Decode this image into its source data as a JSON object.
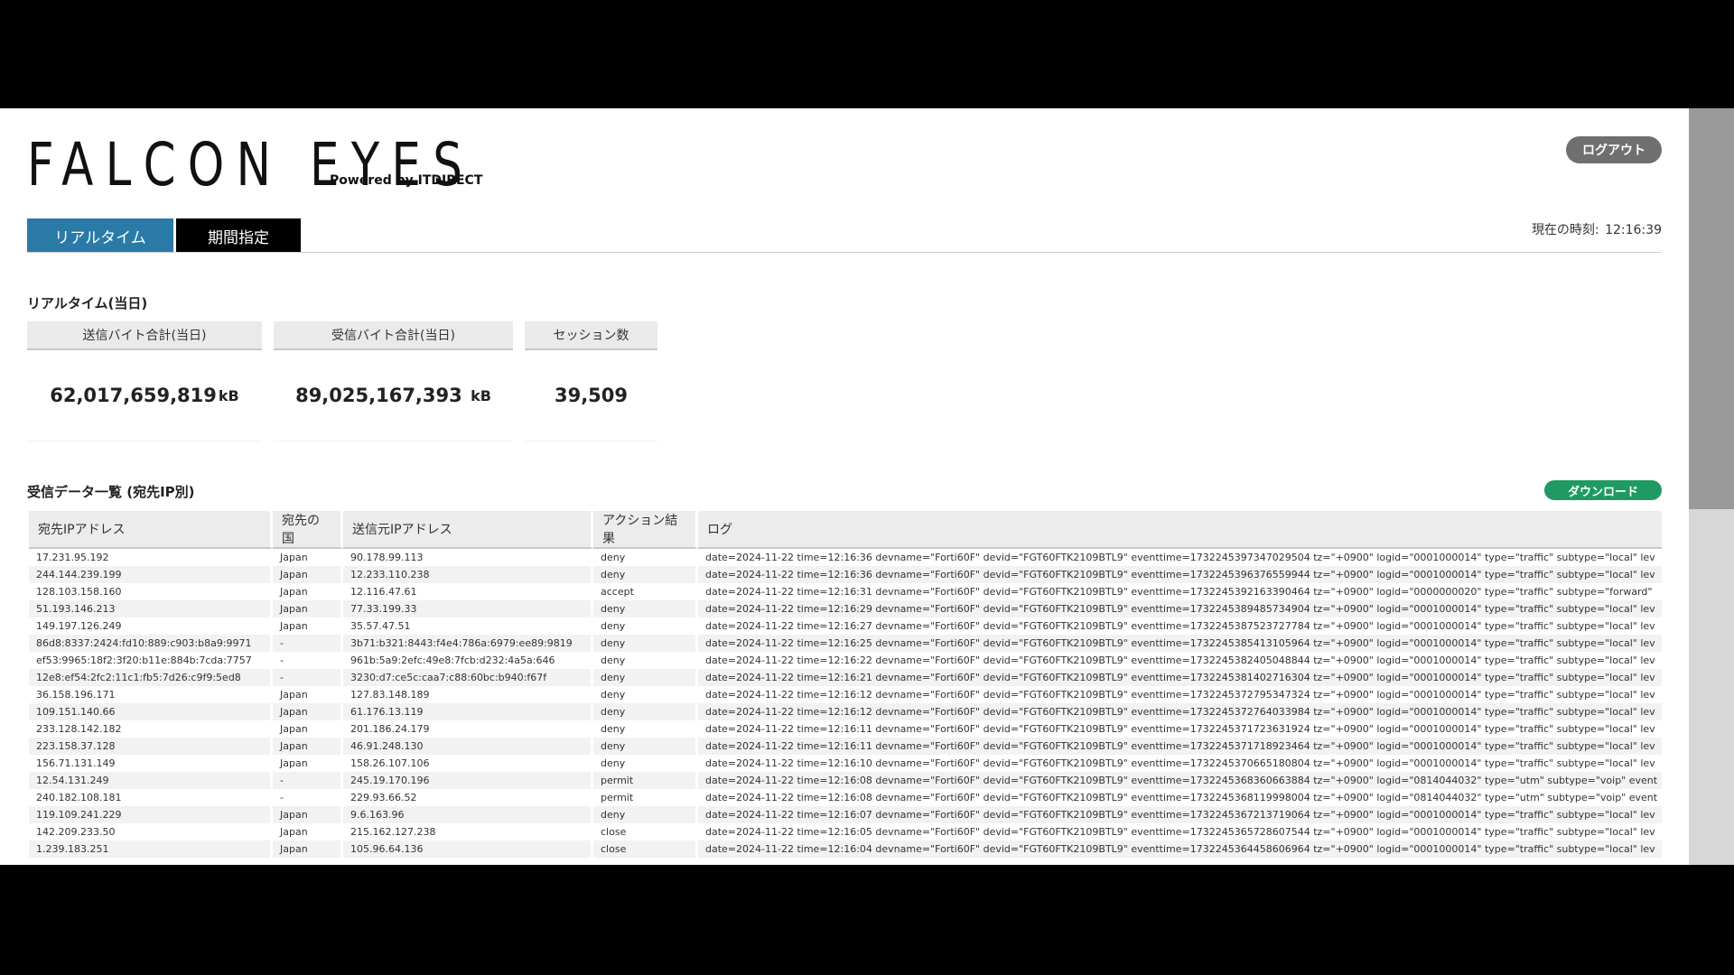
{
  "header": {
    "logo": "FALCON EYES",
    "powered_by": "Powered by ITDIRECT",
    "logout_label": "ログアウト",
    "clock_label": "現在の時刻:",
    "clock_time": "12:16:39"
  },
  "tabs": [
    {
      "label": "リアルタイム",
      "active": true
    },
    {
      "label": "期間指定",
      "active": false
    }
  ],
  "realtime": {
    "title": "リアルタイム(当日)",
    "stats": [
      {
        "label": "送信バイト合計(当日)",
        "value": "62,017,659,819",
        "unit": "kB"
      },
      {
        "label": "受信バイト合計(当日)",
        "value": "89,025,167,393",
        "unit": "kB"
      },
      {
        "label": "セッション数",
        "value": "39,509",
        "unit": ""
      }
    ]
  },
  "received": {
    "title": "受信データ一覧 (宛先IP別)",
    "download_label": "ダウンロード",
    "columns": [
      "宛先IPアドレス",
      "宛先の国",
      "送信元IPアドレス",
      "アクション結果",
      "ログ"
    ],
    "rows": [
      [
        "17.231.95.192",
        "Japan",
        "90.178.99.113",
        "deny",
        "date=2024-11-22 time=12:16:36 devname=\"Forti60F\" devid=\"FGT60FTK2109BTL9\" eventtime=1732245397347029504 tz=\"+0900\" logid=\"0001000014\" type=\"traffic\" subtype=\"local\" lev"
      ],
      [
        "244.144.239.199",
        "Japan",
        "12.233.110.238",
        "deny",
        "date=2024-11-22 time=12:16:36 devname=\"Forti60F\" devid=\"FGT60FTK2109BTL9\" eventtime=1732245396376559944 tz=\"+0900\" logid=\"0001000014\" type=\"traffic\" subtype=\"local\" lev"
      ],
      [
        "128.103.158.160",
        "Japan",
        "12.116.47.61",
        "accept",
        "date=2024-11-22 time=12:16:31 devname=\"Forti60F\" devid=\"FGT60FTK2109BTL9\" eventtime=1732245392163390464 tz=\"+0900\" logid=\"0000000020\" type=\"traffic\" subtype=\"forward\""
      ],
      [
        "51.193.146.213",
        "Japan",
        "77.33.199.33",
        "deny",
        "date=2024-11-22 time=12:16:29 devname=\"Forti60F\" devid=\"FGT60FTK2109BTL9\" eventtime=1732245389485734904 tz=\"+0900\" logid=\"0001000014\" type=\"traffic\" subtype=\"local\" lev"
      ],
      [
        "149.197.126.249",
        "Japan",
        "35.57.47.51",
        "deny",
        "date=2024-11-22 time=12:16:27 devname=\"Forti60F\" devid=\"FGT60FTK2109BTL9\" eventtime=1732245387523727784 tz=\"+0900\" logid=\"0001000014\" type=\"traffic\" subtype=\"local\" lev"
      ],
      [
        "86d8:8337:2424:fd10:889:c903:b8a9:9971",
        "-",
        "3b71:b321:8443:f4e4:786a:6979:ee89:9819",
        "deny",
        "date=2024-11-22 time=12:16:25 devname=\"Forti60F\" devid=\"FGT60FTK2109BTL9\" eventtime=1732245385413105964 tz=\"+0900\" logid=\"0001000014\" type=\"traffic\" subtype=\"local\" lev"
      ],
      [
        "ef53:9965:18f2:3f20:b11e:884b:7cda:7757",
        "-",
        "961b:5a9:2efc:49e8:7fcb:d232:4a5a:646",
        "deny",
        "date=2024-11-22 time=12:16:22 devname=\"Forti60F\" devid=\"FGT60FTK2109BTL9\" eventtime=1732245382405048844 tz=\"+0900\" logid=\"0001000014\" type=\"traffic\" subtype=\"local\" lev"
      ],
      [
        "12e8:ef54:2fc2:11c1:fb5:7d26:c9f9:5ed8",
        "-",
        "3230:d7:ce5c:caa7:c88:60bc:b940:f67f",
        "deny",
        "date=2024-11-22 time=12:16:21 devname=\"Forti60F\" devid=\"FGT60FTK2109BTL9\" eventtime=1732245381402716304 tz=\"+0900\" logid=\"0001000014\" type=\"traffic\" subtype=\"local\" lev"
      ],
      [
        "36.158.196.171",
        "Japan",
        "127.83.148.189",
        "deny",
        "date=2024-11-22 time=12:16:12 devname=\"Forti60F\" devid=\"FGT60FTK2109BTL9\" eventtime=1732245372795347324 tz=\"+0900\" logid=\"0001000014\" type=\"traffic\" subtype=\"local\" lev"
      ],
      [
        "109.151.140.66",
        "Japan",
        "61.176.13.119",
        "deny",
        "date=2024-11-22 time=12:16:12 devname=\"Forti60F\" devid=\"FGT60FTK2109BTL9\" eventtime=1732245372764033984 tz=\"+0900\" logid=\"0001000014\" type=\"traffic\" subtype=\"local\" lev"
      ],
      [
        "233.128.142.182",
        "Japan",
        "201.186.24.179",
        "deny",
        "date=2024-11-22 time=12:16:11 devname=\"Forti60F\" devid=\"FGT60FTK2109BTL9\" eventtime=1732245371723631924 tz=\"+0900\" logid=\"0001000014\" type=\"traffic\" subtype=\"local\" lev"
      ],
      [
        "223.158.37.128",
        "Japan",
        "46.91.248.130",
        "deny",
        "date=2024-11-22 time=12:16:11 devname=\"Forti60F\" devid=\"FGT60FTK2109BTL9\" eventtime=1732245371718923464 tz=\"+0900\" logid=\"0001000014\" type=\"traffic\" subtype=\"local\" lev"
      ],
      [
        "156.71.131.149",
        "Japan",
        "158.26.107.106",
        "deny",
        "date=2024-11-22 time=12:16:10 devname=\"Forti60F\" devid=\"FGT60FTK2109BTL9\" eventtime=1732245370665180804 tz=\"+0900\" logid=\"0001000014\" type=\"traffic\" subtype=\"local\" lev"
      ],
      [
        "12.54.131.249",
        "-",
        "245.19.170.196",
        "permit",
        "date=2024-11-22 time=12:16:08 devname=\"Forti60F\" devid=\"FGT60FTK2109BTL9\" eventtime=1732245368360663884 tz=\"+0900\" logid=\"0814044032\" type=\"utm\" subtype=\"voip\" event"
      ],
      [
        "240.182.108.181",
        "-",
        "229.93.66.52",
        "permit",
        "date=2024-11-22 time=12:16:08 devname=\"Forti60F\" devid=\"FGT60FTK2109BTL9\" eventtime=1732245368119998004 tz=\"+0900\" logid=\"0814044032\" type=\"utm\" subtype=\"voip\" event"
      ],
      [
        "119.109.241.229",
        "Japan",
        "9.6.163.96",
        "deny",
        "date=2024-11-22 time=12:16:07 devname=\"Forti60F\" devid=\"FGT60FTK2109BTL9\" eventtime=1732245367213719064 tz=\"+0900\" logid=\"0001000014\" type=\"traffic\" subtype=\"local\" lev"
      ],
      [
        "142.209.233.50",
        "Japan",
        "215.162.127.238",
        "close",
        "date=2024-11-22 time=12:16:05 devname=\"Forti60F\" devid=\"FGT60FTK2109BTL9\" eventtime=1732245365728607544 tz=\"+0900\" logid=\"0001000014\" type=\"traffic\" subtype=\"local\" lev"
      ],
      [
        "1.239.183.251",
        "Japan",
        "105.96.64.136",
        "close",
        "date=2024-11-22 time=12:16:04 devname=\"Forti60F\" devid=\"FGT60FTK2109BTL9\" eventtime=1732245364458606964 tz=\"+0900\" logid=\"0001000014\" type=\"traffic\" subtype=\"local\" lev"
      ]
    ]
  },
  "colors": {
    "tab_active": "#2a7aa8",
    "tab_inactive": "#000000",
    "download": "#1e9a62",
    "logout": "#6f6f6f"
  }
}
